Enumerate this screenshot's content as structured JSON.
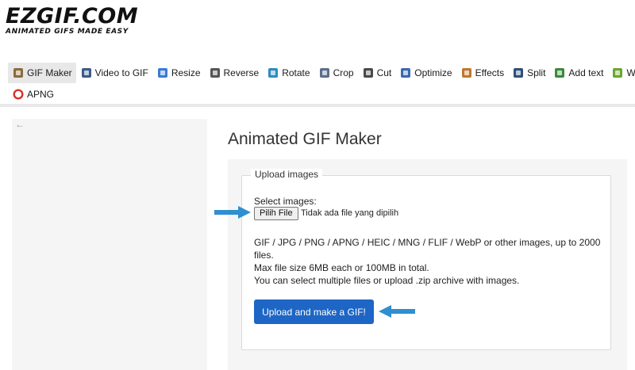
{
  "logo": {
    "main": "EZGIF.COM",
    "tagline": "ANIMATED GIFS MADE EASY"
  },
  "nav": {
    "items": [
      {
        "label": "GIF Maker",
        "icon": "gif-maker-icon",
        "color": "#8a6d3b",
        "active": true
      },
      {
        "label": "Video to GIF",
        "icon": "video-icon",
        "color": "#3b5b8a"
      },
      {
        "label": "Resize",
        "icon": "resize-icon",
        "color": "#3a7bd5"
      },
      {
        "label": "Reverse",
        "icon": "reverse-icon",
        "color": "#555555"
      },
      {
        "label": "Rotate",
        "icon": "rotate-icon",
        "color": "#2e8bc0"
      },
      {
        "label": "Crop",
        "icon": "crop-icon",
        "color": "#5a6f8a"
      },
      {
        "label": "Cut",
        "icon": "cut-icon",
        "color": "#4a4a4a"
      },
      {
        "label": "Optimize",
        "icon": "optimize-icon",
        "color": "#3a68b0"
      },
      {
        "label": "Effects",
        "icon": "effects-icon",
        "color": "#c0782e"
      },
      {
        "label": "Split",
        "icon": "split-icon",
        "color": "#2f4f7a"
      },
      {
        "label": "Add text",
        "icon": "add-text-icon",
        "color": "#3a8a3a"
      },
      {
        "label": "WebP",
        "icon": "webp-icon",
        "color": "#6aa62f"
      },
      {
        "label": "APNG",
        "icon": "apng-icon",
        "color": "#d8322a"
      }
    ]
  },
  "main": {
    "title": "Animated GIF Maker",
    "fieldset_legend": "Upload images",
    "select_label": "Select images:",
    "file_button": "Pilih File",
    "file_status": "Tidak ada file yang dipilih",
    "info_lines": [
      "GIF / JPG / PNG / APNG / HEIC / MNG / FLIF / WebP or other images, up to 2000 files.",
      "Max file size 6MB each or 100MB in total.",
      "You can select multiple files or upload .zip archive with images."
    ],
    "submit_button": "Upload and make a GIF!"
  },
  "colors": {
    "accent": "#1e66c5",
    "callout_arrow": "#2f8fd0"
  }
}
